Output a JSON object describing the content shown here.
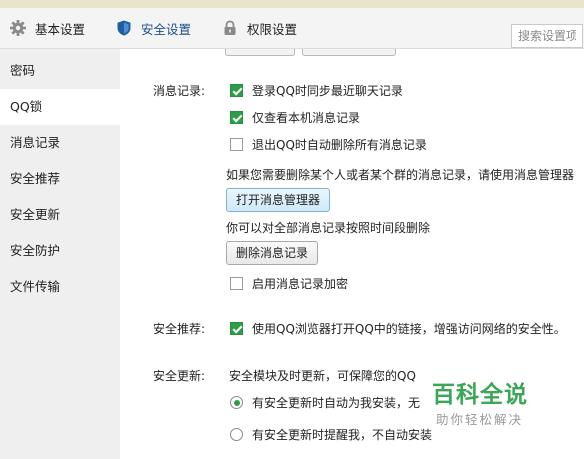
{
  "tabs": [
    {
      "label": "基本设置",
      "icon": "gear-icon"
    },
    {
      "label": "安全设置",
      "icon": "shield-icon"
    },
    {
      "label": "权限设置",
      "icon": "lock-icon"
    }
  ],
  "search": {
    "placeholder": "搜索设置项"
  },
  "sidebar": {
    "items": [
      {
        "label": "密码"
      },
      {
        "label": "QQ锁"
      },
      {
        "label": "消息记录"
      },
      {
        "label": "安全推荐"
      },
      {
        "label": "安全更新"
      },
      {
        "label": "安全防护"
      },
      {
        "label": "文件传输"
      }
    ],
    "selected_index": 1
  },
  "message_records": {
    "label": "消息记录:",
    "options": [
      {
        "label": "登录QQ时同步最近聊天记录",
        "checked": true
      },
      {
        "label": "仅查看本机消息记录",
        "checked": true
      },
      {
        "label": "退出QQ时自动删除所有消息记录",
        "checked": false
      }
    ],
    "manager_hint": "如果您需要删除某个人或者某个群的消息记录，请使用消息管理器",
    "open_manager_button": "打开消息管理器",
    "delete_hint": "你可以对全部消息记录按照时间段删除",
    "delete_button": "删除消息记录",
    "encrypt_option": {
      "label": "启用消息记录加密",
      "checked": false
    }
  },
  "security_recommend": {
    "label": "安全推荐:",
    "option": {
      "label": "使用QQ浏览器打开QQ中的链接，增强访问网络的安全性。",
      "checked": true
    }
  },
  "security_update": {
    "label": "安全更新:",
    "description": "安全模块及时更新，可保障您的QQ",
    "options": [
      {
        "label": "有安全更新时自动为我安装，无",
        "selected": true
      },
      {
        "label": "有安全更新时提醒我，不自动安装",
        "selected": false
      }
    ]
  },
  "watermark": {
    "title": "百科全说",
    "subtitle": "助你轻松解决"
  },
  "colors": {
    "accent_green": "#2e9d48",
    "tab_active": "#1a4f8c",
    "watermark_green": "#3aa756"
  }
}
